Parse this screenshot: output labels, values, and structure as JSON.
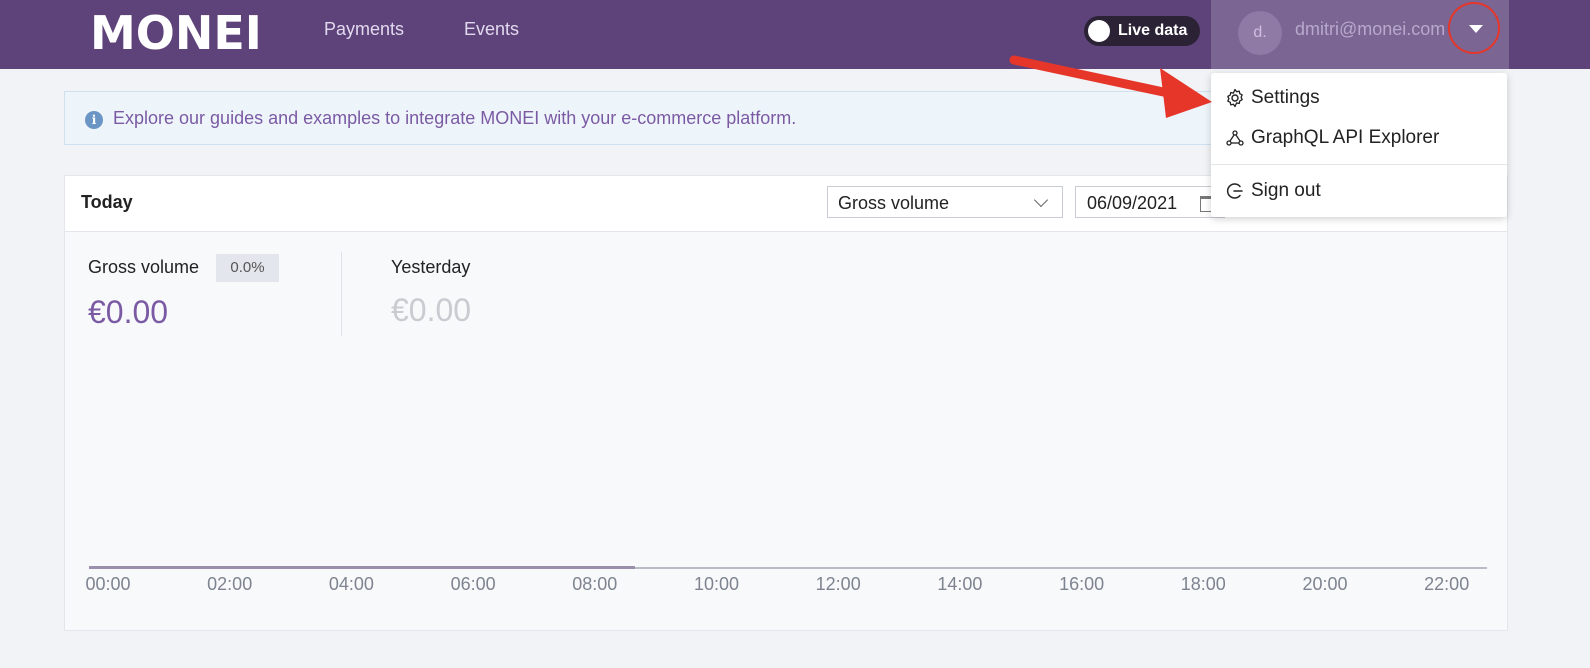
{
  "header": {
    "logo": "MONEI",
    "nav": [
      "Payments",
      "Events"
    ],
    "live_toggle_label": "Live data",
    "account": {
      "avatar_initials": "d.",
      "email": "dmitri@monei.com"
    }
  },
  "banner": {
    "text": "Explore our guides and examples to integrate MONEI with your e-commerce platform."
  },
  "card": {
    "title": "Today",
    "metric_select": "Gross volume",
    "date": "06/09/2021",
    "gross_volume_label": "Gross volume",
    "change_badge": "0.0%",
    "gross_volume_value": "€0.00",
    "yesterday_label": "Yesterday",
    "yesterday_value": "€0.00",
    "x_ticks": [
      "00:00",
      "02:00",
      "04:00",
      "06:00",
      "08:00",
      "10:00",
      "12:00",
      "14:00",
      "16:00",
      "18:00",
      "20:00",
      "22:00"
    ]
  },
  "dropdown": {
    "items": [
      {
        "label": "Settings",
        "icon": "gear-icon"
      },
      {
        "label": "GraphQL API Explorer",
        "icon": "graph-icon"
      },
      {
        "label": "Sign out",
        "icon": "sign-out-icon"
      }
    ]
  },
  "colors": {
    "topbar": "#5d437a",
    "accent_purple": "#7b5aa4",
    "annotation_red": "#e6362a"
  }
}
